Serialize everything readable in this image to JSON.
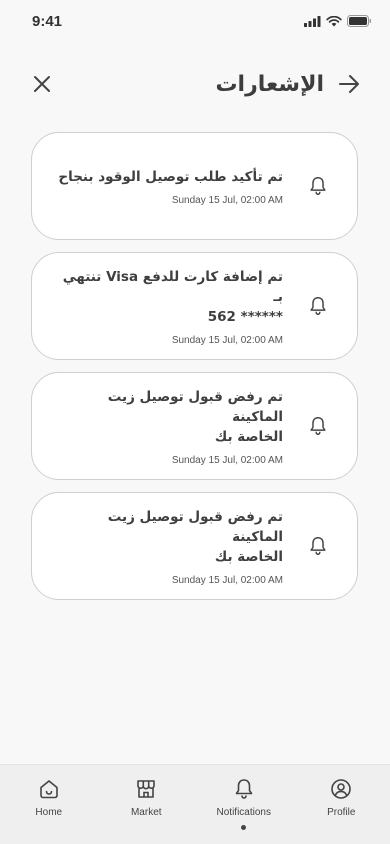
{
  "status_bar": {
    "time": "9:41"
  },
  "header": {
    "title": "الإشعارات"
  },
  "notifications": [
    {
      "title_line1": "تم تأكيد طلب توصيل الوقود بنجاح",
      "title_line2": "",
      "date": "Sunday 15 Jul, 02:00 AM"
    },
    {
      "title_line1": "تم إضافة كارت للدفع Visa تنتهي بـ",
      "title_line2": "562 ******",
      "date": "Sunday 15 Jul, 02:00 AM"
    },
    {
      "title_line1": "تم رفض قبول توصيل زيت الماكينة",
      "title_line2": "الخاصة بك",
      "date": "Sunday 15 Jul, 02:00 AM"
    },
    {
      "title_line1": "تم رفض قبول توصيل زيت الماكينة",
      "title_line2": "الخاصة بك",
      "date": "Sunday 15 Jul, 02:00 AM"
    }
  ],
  "tabbar": {
    "items": [
      {
        "label": "Home",
        "icon": "home-icon"
      },
      {
        "label": "Market",
        "icon": "market-icon"
      },
      {
        "label": "Notifications",
        "icon": "bell-icon",
        "active": true
      },
      {
        "label": "Profile",
        "icon": "profile-icon"
      }
    ]
  }
}
